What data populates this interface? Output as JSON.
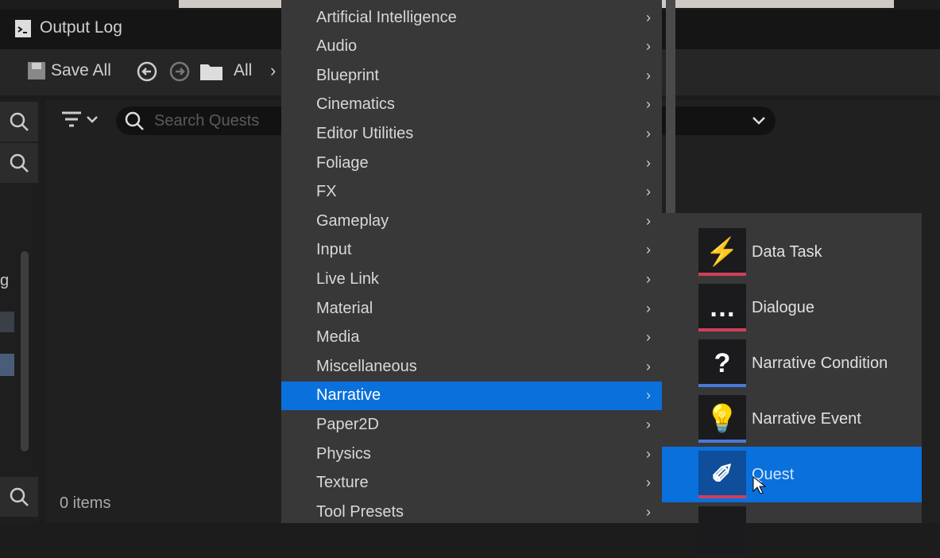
{
  "tab": {
    "title": "Output Log",
    "icon": "output-log-icon"
  },
  "toolbar": {
    "save_all": "Save All",
    "path": "All"
  },
  "search": {
    "placeholder": "Search Quests"
  },
  "status": {
    "items": "0 items"
  },
  "menu": {
    "items": [
      "Artificial Intelligence",
      "Audio",
      "Blueprint",
      "Cinematics",
      "Editor Utilities",
      "Foliage",
      "FX",
      "Gameplay",
      "Input",
      "Live Link",
      "Material",
      "Media",
      "Miscellaneous",
      "Narrative",
      "Paper2D",
      "Physics",
      "Texture",
      "Tool Presets"
    ],
    "selected": "Narrative"
  },
  "submenu": {
    "items": [
      {
        "label": "Data Task",
        "icon": "data-task-icon",
        "color": "#d0405a"
      },
      {
        "label": "Dialogue",
        "icon": "dialogue-icon",
        "color": "#d0405a"
      },
      {
        "label": "Narrative Condition",
        "icon": "question-icon",
        "color": "#4a78d8"
      },
      {
        "label": "Narrative Event",
        "icon": "lightbulb-icon",
        "color": "#4a78d8"
      },
      {
        "label": "Quest",
        "icon": "scroll-icon",
        "color": "#d0405a"
      }
    ],
    "selected": "Quest"
  },
  "colors": {
    "accent": "#0a70dc",
    "menu_bg": "#383838"
  },
  "left_sidebar": {
    "partial_label": "g"
  }
}
